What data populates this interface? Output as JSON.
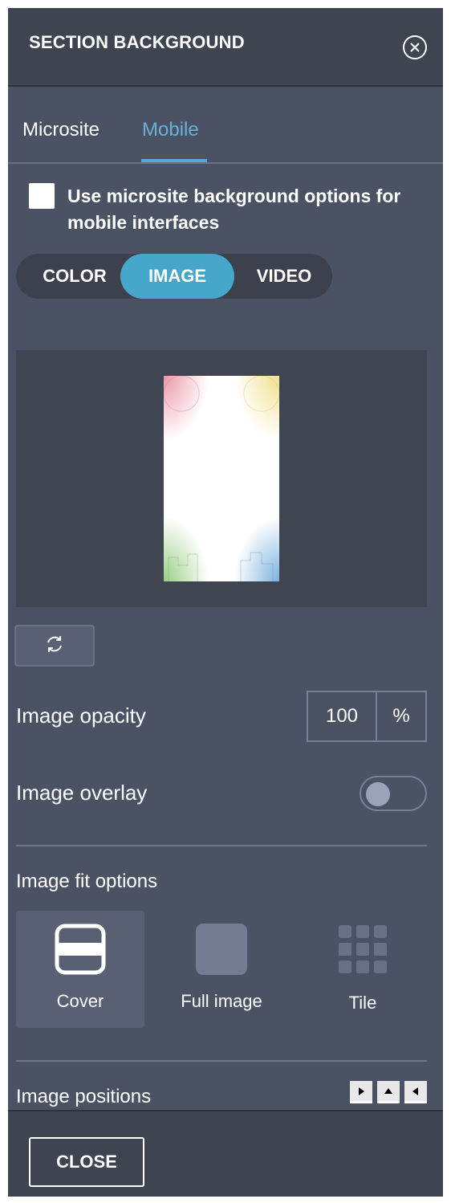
{
  "header": {
    "title": "SECTION BACKGROUND",
    "close_icon": "circle-close-icon"
  },
  "tabs": [
    {
      "label": "Microsite",
      "active": false
    },
    {
      "label": "Mobile",
      "active": true
    }
  ],
  "mobile_option": {
    "label": "Use microsite background options for mobile interfaces",
    "checked": false
  },
  "background_type": {
    "options": [
      "COLOR",
      "IMAGE",
      "VIDEO"
    ],
    "selected": "IMAGE"
  },
  "image": {
    "refresh_icon": "refresh-icon"
  },
  "opacity": {
    "label": "Image opacity",
    "value": "100",
    "unit": "%"
  },
  "overlay": {
    "label": "Image overlay",
    "enabled": false
  },
  "fit": {
    "label": "Image fit options",
    "options": [
      {
        "label": "Cover",
        "icon": "cover-icon"
      },
      {
        "label": "Full image",
        "icon": "full-image-icon"
      },
      {
        "label": "Tile",
        "icon": "tile-icon"
      }
    ],
    "selected": "Cover"
  },
  "positions": {
    "label": "Image positions",
    "arrows": [
      "arrow-right-icon",
      "arrow-up-icon",
      "arrow-left-icon"
    ]
  },
  "footer": {
    "close_label": "CLOSE"
  },
  "colors": {
    "panel": "#4b5264",
    "header": "#3f4451",
    "accent": "#47a6cc",
    "tab_active": "#6ab2d8"
  }
}
